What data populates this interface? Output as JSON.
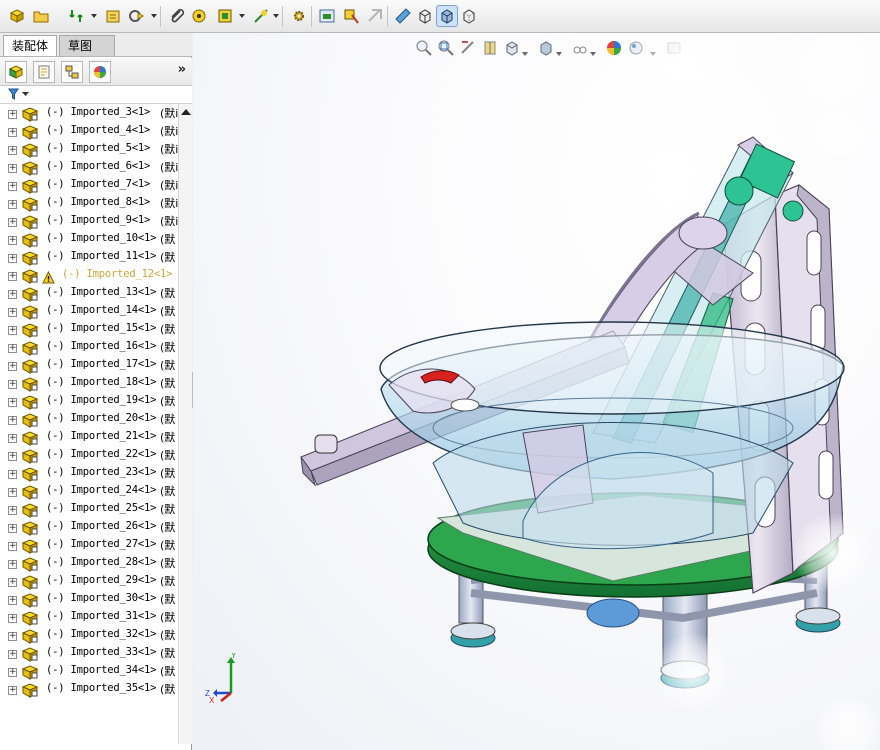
{
  "tabs": {
    "assembly": "装配体",
    "sketch": "草图"
  },
  "manager": {
    "expand_symbol": "»"
  },
  "tree": {
    "items": [
      {
        "label": "(-) Imported_3<1>",
        "suffix": "(默i",
        "warning": false
      },
      {
        "label": "(-) Imported_4<1>",
        "suffix": "(默i",
        "warning": false
      },
      {
        "label": "(-) Imported_5<1>",
        "suffix": "(默i",
        "warning": false
      },
      {
        "label": "(-) Imported_6<1>",
        "suffix": "(默i",
        "warning": false
      },
      {
        "label": "(-) Imported_7<1>",
        "suffix": "(默i",
        "warning": false
      },
      {
        "label": "(-) Imported_8<1>",
        "suffix": "(默i",
        "warning": false
      },
      {
        "label": "(-) Imported_9<1>",
        "suffix": "(默i",
        "warning": false
      },
      {
        "label": "(-) Imported_10<1>",
        "suffix": "(默",
        "warning": false
      },
      {
        "label": "(-) Imported_11<1>",
        "suffix": "(默",
        "warning": false
      },
      {
        "label": "(-) Imported_12<1>",
        "suffix": "",
        "warning": true
      },
      {
        "label": "(-) Imported_13<1>",
        "suffix": "(默",
        "warning": false
      },
      {
        "label": "(-) Imported_14<1>",
        "suffix": "(默",
        "warning": false
      },
      {
        "label": "(-) Imported_15<1>",
        "suffix": "(默",
        "warning": false
      },
      {
        "label": "(-) Imported_16<1>",
        "suffix": "(默",
        "warning": false
      },
      {
        "label": "(-) Imported_17<1>",
        "suffix": "(默",
        "warning": false
      },
      {
        "label": "(-) Imported_18<1>",
        "suffix": "(默",
        "warning": false
      },
      {
        "label": "(-) Imported_19<1>",
        "suffix": "(默",
        "warning": false
      },
      {
        "label": "(-) Imported_20<1>",
        "suffix": "(默",
        "warning": false
      },
      {
        "label": "(-) Imported_21<1>",
        "suffix": "(默",
        "warning": false
      },
      {
        "label": "(-) Imported_22<1>",
        "suffix": "(默",
        "warning": false
      },
      {
        "label": "(-) Imported_23<1>",
        "suffix": "(默",
        "warning": false
      },
      {
        "label": "(-) Imported_24<1>",
        "suffix": "(默",
        "warning": false
      },
      {
        "label": "(-) Imported_25<1>",
        "suffix": "(默",
        "warning": false
      },
      {
        "label": "(-) Imported_26<1>",
        "suffix": "(默",
        "warning": false
      },
      {
        "label": "(-) Imported_27<1>",
        "suffix": "(默",
        "warning": false
      },
      {
        "label": "(-) Imported_28<1>",
        "suffix": "(默",
        "warning": false
      },
      {
        "label": "(-) Imported_29<1>",
        "suffix": "(默",
        "warning": false
      },
      {
        "label": "(-) Imported_30<1>",
        "suffix": "(默",
        "warning": false
      },
      {
        "label": "(-) Imported_31<1>",
        "suffix": "(默",
        "warning": false
      },
      {
        "label": "(-) Imported_32<1>",
        "suffix": "(默",
        "warning": false
      },
      {
        "label": "(-) Imported_33<1>",
        "suffix": "(默",
        "warning": false
      },
      {
        "label": "(-) Imported_34<1>",
        "suffix": "(默",
        "warning": false
      },
      {
        "label": "(-) Imported_35<1>",
        "suffix": "(默",
        "warning": false
      }
    ]
  },
  "triad": {
    "x": "X",
    "y": "Y",
    "z": "Z"
  },
  "colors": {
    "part_yellow": "#f3d21b",
    "base_green": "#1a8a3a",
    "frame_gray": "#d6cfe0",
    "bowl_blue": "#9fd0e6",
    "warning_gold": "#c9a83a"
  }
}
